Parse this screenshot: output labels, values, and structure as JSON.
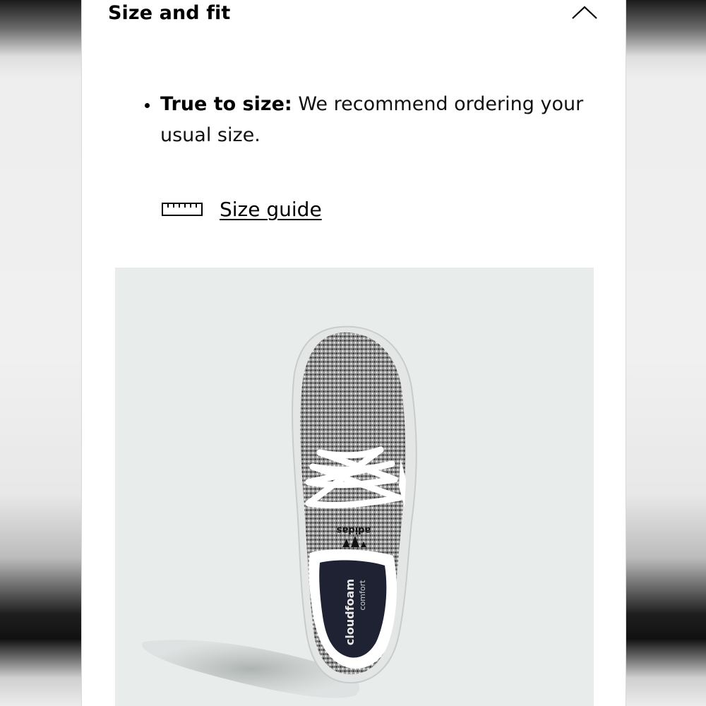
{
  "size_and_fit": {
    "title": "Size and fit",
    "expanded": true,
    "items": [
      {
        "label": "True to size:",
        "text": "We recommend ordering your usual size."
      }
    ],
    "size_guide_label": "Size guide"
  },
  "product_image": {
    "description_icon": "sneaker-top-view",
    "brand_text": "adidas",
    "insole_text": "cloudfoam",
    "insole_subtext": "comfort",
    "background_color": "#e8eceb",
    "shoe_color": "#8a8a8a",
    "insole_color": "#1e2233"
  },
  "colors": {
    "text": "#000000",
    "panel_background": "#ffffff"
  }
}
